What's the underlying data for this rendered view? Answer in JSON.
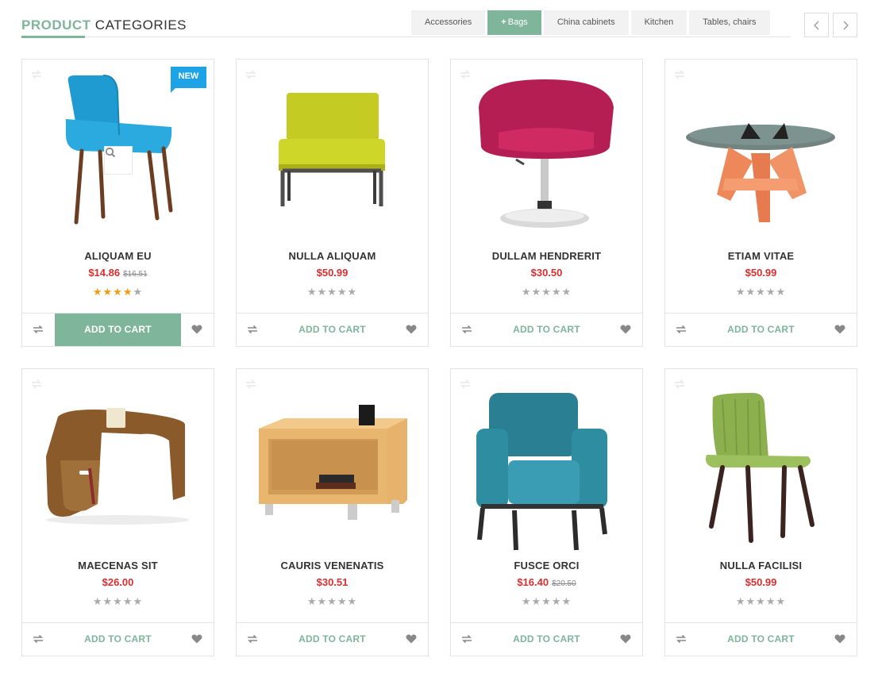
{
  "section": {
    "title_accent": "PRODUCT",
    "title_rest": "CATEGORIES"
  },
  "tabs": [
    "Accessories",
    "Bags",
    "China cabinets",
    "Kitchen",
    "Tables, chairs"
  ],
  "active_tab_prefix": "+",
  "badge_new": "NEW",
  "cart_label": "ADD TO CART",
  "star_glyph": "★",
  "products": [
    {
      "name": "ALIQUAM EU",
      "price": "$14.86",
      "old_price": "$16.51",
      "rating": 4
    },
    {
      "name": "NULLA ALIQUAM",
      "price": "$50.99",
      "old_price": "",
      "rating": 0
    },
    {
      "name": "DULLAM HENDRERIT",
      "price": "$30.50",
      "old_price": "",
      "rating": 0
    },
    {
      "name": "ETIAM VITAE",
      "price": "$50.99",
      "old_price": "",
      "rating": 0
    },
    {
      "name": "MAECENAS SIT",
      "price": "$26.00",
      "old_price": "",
      "rating": 0
    },
    {
      "name": "CAURIS VENENATIS",
      "price": "$30.51",
      "old_price": "",
      "rating": 0
    },
    {
      "name": "FUSCE ORCI",
      "price": "$16.40",
      "old_price": "$20.50",
      "rating": 0
    },
    {
      "name": "NULLA FACILISI",
      "price": "$50.99",
      "old_price": "",
      "rating": 0
    }
  ],
  "colors": {
    "accent": "#7fb59b",
    "price": "#d62f2f",
    "badge": "#1ea3e6",
    "star_on": "#f39c12",
    "star_off": "#aaaaaa"
  }
}
